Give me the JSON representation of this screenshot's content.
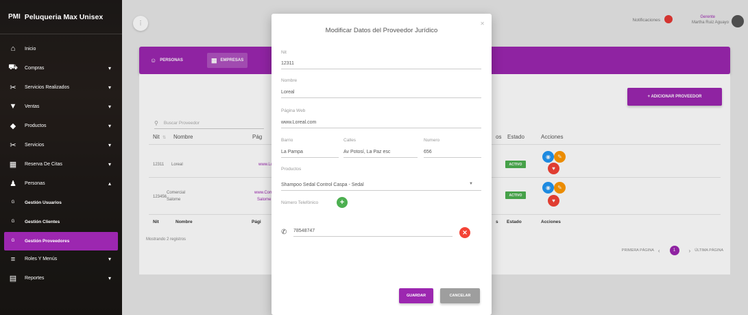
{
  "brand": {
    "abbr": "PMI",
    "name": "Peluqueria Max Unisex"
  },
  "sidebar": {
    "items": [
      {
        "icon": "⌂",
        "icon_name": "home-icon",
        "label": "Inicio",
        "caret": ""
      },
      {
        "icon": "⛟",
        "icon_name": "cart-icon",
        "label": "Compras",
        "caret": "▾"
      },
      {
        "icon": "✂",
        "icon_name": "services-icon",
        "label": "Servicios Realizados",
        "caret": "▾"
      },
      {
        "icon": "▼",
        "icon_name": "sales-icon",
        "label": "Ventas",
        "caret": "▾"
      },
      {
        "icon": "◆",
        "icon_name": "products-icon",
        "label": "Productos",
        "caret": "▾"
      },
      {
        "icon": "✂",
        "icon_name": "scissors-icon",
        "label": "Servicios",
        "caret": "▾"
      },
      {
        "icon": "▦",
        "icon_name": "calendar-icon",
        "label": "Reserva De Citas",
        "caret": "▾"
      },
      {
        "icon": "♟",
        "icon_name": "person-icon",
        "label": "Personas",
        "caret": "▾"
      },
      {
        "icon": "G",
        "icon_name": "g-icon",
        "label": "Gestión Usuarios",
        "caret": ""
      },
      {
        "icon": "G",
        "icon_name": "g-icon",
        "label": "Gestión Clientes",
        "caret": ""
      },
      {
        "icon": "G",
        "icon_name": "g-icon",
        "label": "Gestión Proveedores",
        "caret": ""
      },
      {
        "icon": "≡",
        "icon_name": "list-icon",
        "label": "Roles Y Menús",
        "caret": "▾"
      },
      {
        "icon": "▤",
        "icon_name": "report-icon",
        "label": "Reportes",
        "caret": "▾"
      }
    ]
  },
  "topbar": {
    "menu_toggle": "⋮",
    "notifications_label": "Notificaciones",
    "user_role": "Gerente",
    "user_name": "Martha Ruiz Aguayo"
  },
  "tabs": {
    "personas": "PERSONAS",
    "empresas": "EMPRESAS"
  },
  "main": {
    "add_button": "+ ADICIONAR PROVEEDOR",
    "search_placeholder": "Buscar Proveedor",
    "headers": {
      "nit": "Nit",
      "nombre": "Nombre",
      "pagina": "Pág",
      "tel": "os",
      "estado": "Estado",
      "acciones": "Acciones"
    },
    "footers": {
      "nit": "Nit",
      "nombre": "Nombre",
      "pagina": "Pági",
      "tel": "s",
      "estado": "Estado",
      "acciones": "Acciones"
    },
    "rows": [
      {
        "nit": "12311",
        "nombre": "Loreal",
        "nombre2": "",
        "pagina": "www.Lore",
        "pagina2": "",
        "estado": "ACTIVO"
      },
      {
        "nit": "123456",
        "nombre": "Comercial",
        "nombre2": "Salome",
        "pagina": "www.Com",
        "pagina2": "Salome",
        "estado": "ACTIVO"
      }
    ],
    "showing": "Mostrando 2 registros",
    "pager": {
      "first": "PRIMERA PÁGINA",
      "page": "1",
      "last": "ÚLTIMA PÁGINA"
    }
  },
  "modal": {
    "title": "Modificar Datos del Proveedor Jurídico",
    "nit_label": "Nit",
    "nit_value": "12311",
    "nombre_label": "Nombre",
    "nombre_value": "Loreal",
    "pagina_label": "Página Web",
    "pagina_value": "www.Loreal.com",
    "barrio_label": "Barrio",
    "barrio_value": "La Pampa",
    "calles_label": "Calles",
    "calles_value": "Av Potosí, La Paz esc",
    "numero_label": "Numero",
    "numero_value": "656",
    "productos_label": "Productos",
    "productos_value": "Shampoo Sedal Control Caspa - Sedal",
    "telefono_label": "Número Telefónico",
    "telefono_value": "78548747",
    "save": "GUARDAR",
    "cancel": "CANCELAR"
  }
}
